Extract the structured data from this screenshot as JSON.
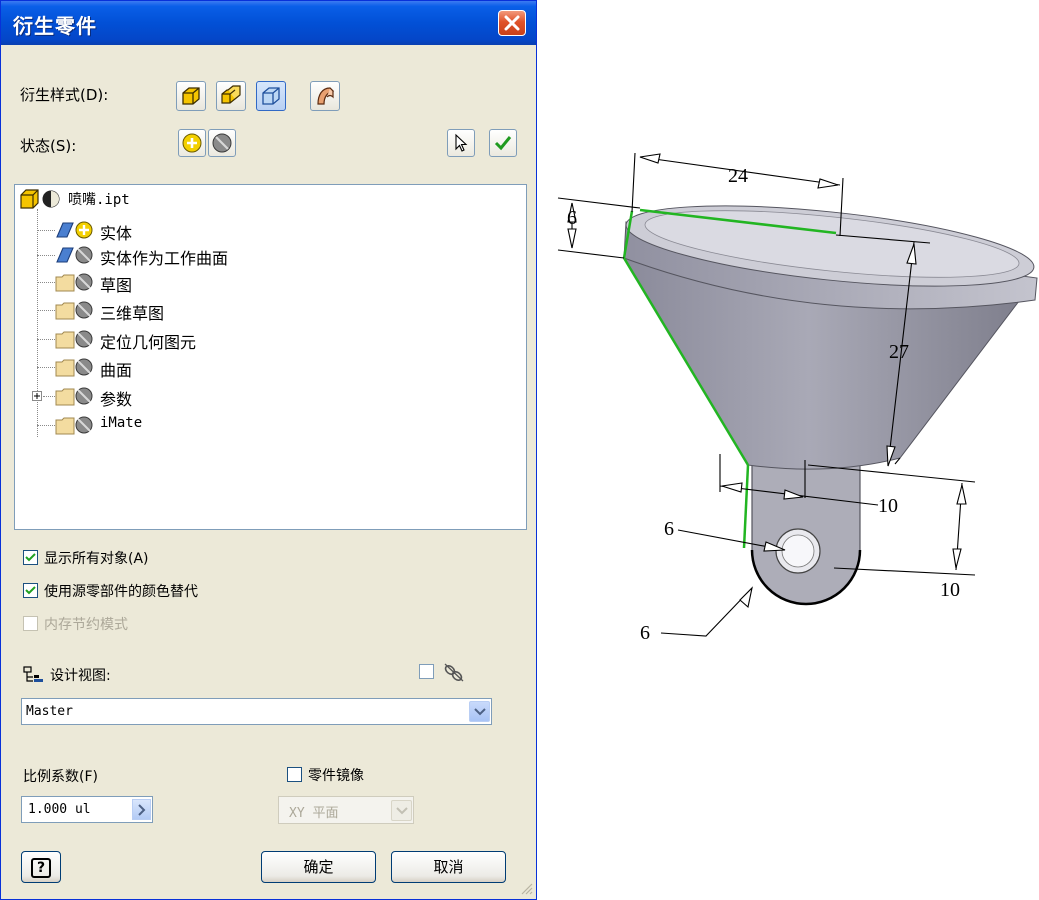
{
  "dialog": {
    "title": "衍生零件",
    "derive_style_label": "衍生样式(D):",
    "status_label": "状态(S):",
    "tree": {
      "root": "喷嘴.ipt",
      "items": [
        "实体",
        "实体作为工作曲面",
        "草图",
        "三维草图",
        "定位几何图元",
        "曲面",
        "参数",
        "iMate"
      ]
    },
    "options": {
      "show_all": "显示所有对象(A)",
      "use_source_color": "使用源零部件的颜色替代",
      "memory_saving": "内存节约模式"
    },
    "design_view_label": "设计视图:",
    "design_view_value": "Master",
    "scale_label": "比例系数(F)",
    "scale_value": "1.000 ul",
    "mirror_label": "零件镜像",
    "mirror_plane": "XY 平面",
    "ok_label": "确定",
    "cancel_label": "取消",
    "help_label": "?"
  },
  "drawing": {
    "dims": [
      "24",
      "6",
      "27",
      "10",
      "10",
      "6",
      "6"
    ]
  },
  "colors": {
    "titlebar": "#0250d6",
    "dialog_bg": "#ece9d8",
    "close_button": "#e0532a",
    "body_gray": "#9a9aa8",
    "edge_green": "#22b522"
  }
}
